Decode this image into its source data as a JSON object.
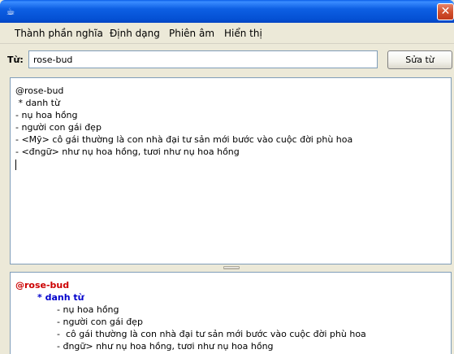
{
  "window": {
    "title": "",
    "app_icon": "java-cup-icon",
    "close_symbol": "✕"
  },
  "menu": {
    "items": [
      "Thành phần nghĩa",
      "Định dạng",
      "Phiên âm",
      "Hiển thị"
    ]
  },
  "word": {
    "label": "Từ:",
    "value": "rose-bud",
    "button_label": "Sửa từ"
  },
  "editor": {
    "lines": [
      "@rose-bud",
      " * danh từ",
      "- nụ hoa hồng",
      "- người con gái đẹp",
      "- <Mỹ> cô gái thường là con nhà đại tư sản mới bước vào cuộc đời phù hoa",
      "- <đngữ> như nụ hoa hồng, tươi như nụ hoa hồng"
    ]
  },
  "preview": {
    "headword": "@rose-bud",
    "part_of_speech": "* danh từ",
    "senses": [
      "- nụ hoa hồng",
      "- người con gái đẹp",
      "-  cô gái thường là con nhà đại tư sản mới bước vào cuộc đời phù hoa",
      "- đngữ> như nụ hoa hồng, tươi như nụ hoa hồng"
    ]
  },
  "colors": {
    "titlebar": "#0450d3",
    "headword": "#cc0000",
    "part_of_speech": "#0000cc"
  }
}
